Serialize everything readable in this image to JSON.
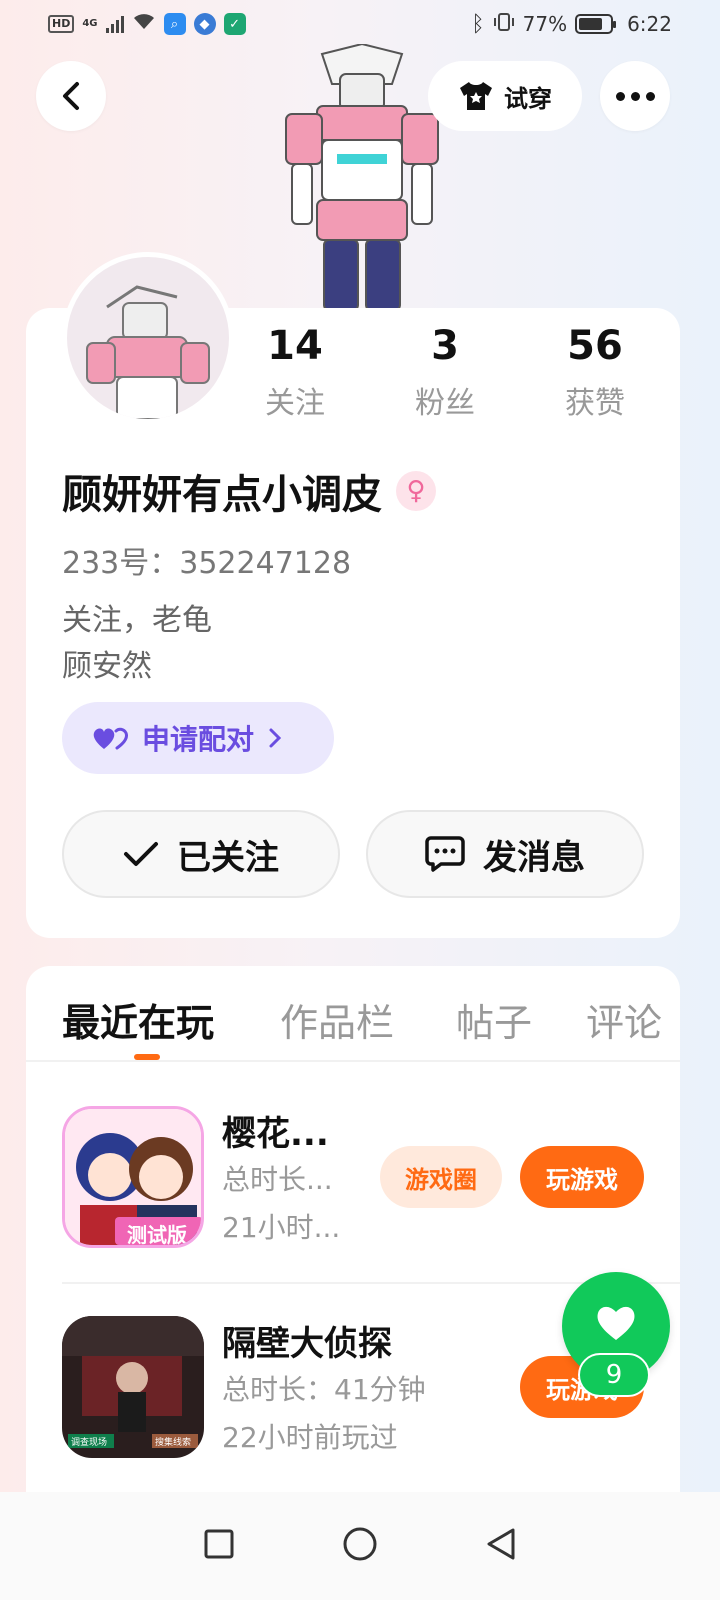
{
  "status_bar": {
    "hd": "HD",
    "network": "4G",
    "battery": "77%",
    "battery_level": 0.77,
    "time": "6:22"
  },
  "header": {
    "back_icon": "chevron-left-icon",
    "try_on_label": "试穿",
    "try_on_icon": "tshirt-icon",
    "more_icon": "more-dots-icon"
  },
  "profile": {
    "stats": [
      {
        "value": "14",
        "label": "关注"
      },
      {
        "value": "3",
        "label": "粉丝"
      },
      {
        "value": "56",
        "label": "获赞"
      }
    ],
    "name": "顾妍妍有点小调皮",
    "gender_icon": "♀",
    "user_id": "233号：352247128",
    "bio_line1": "关注，老龟",
    "bio_line2": "顾安然",
    "pair_label": "申请配对",
    "follow_label": "已关注",
    "message_label": "发消息"
  },
  "tabs": [
    {
      "label": "最近在玩",
      "active": true
    },
    {
      "label": "作品栏",
      "active": false
    },
    {
      "label": "帖子",
      "active": false
    },
    {
      "label": "评论",
      "active": false
    }
  ],
  "games": [
    {
      "title": "樱花...",
      "duration": "总时长...",
      "last_played": "21小时...",
      "icon_badge": "测试版",
      "circle_label": "游戏圈",
      "play_label": "玩游戏"
    },
    {
      "title": "隔壁大侦探",
      "duration": "总时长：41分钟",
      "last_played": "22小时前玩过",
      "icon_badge_left": "调查现场",
      "icon_badge_right": "搜集线索",
      "play_label": "玩游戏"
    }
  ],
  "like": {
    "count": "9"
  },
  "colors": {
    "accent": "#ff6a13",
    "like_green": "#11c95a",
    "pair_purple": "#6a4de0"
  }
}
